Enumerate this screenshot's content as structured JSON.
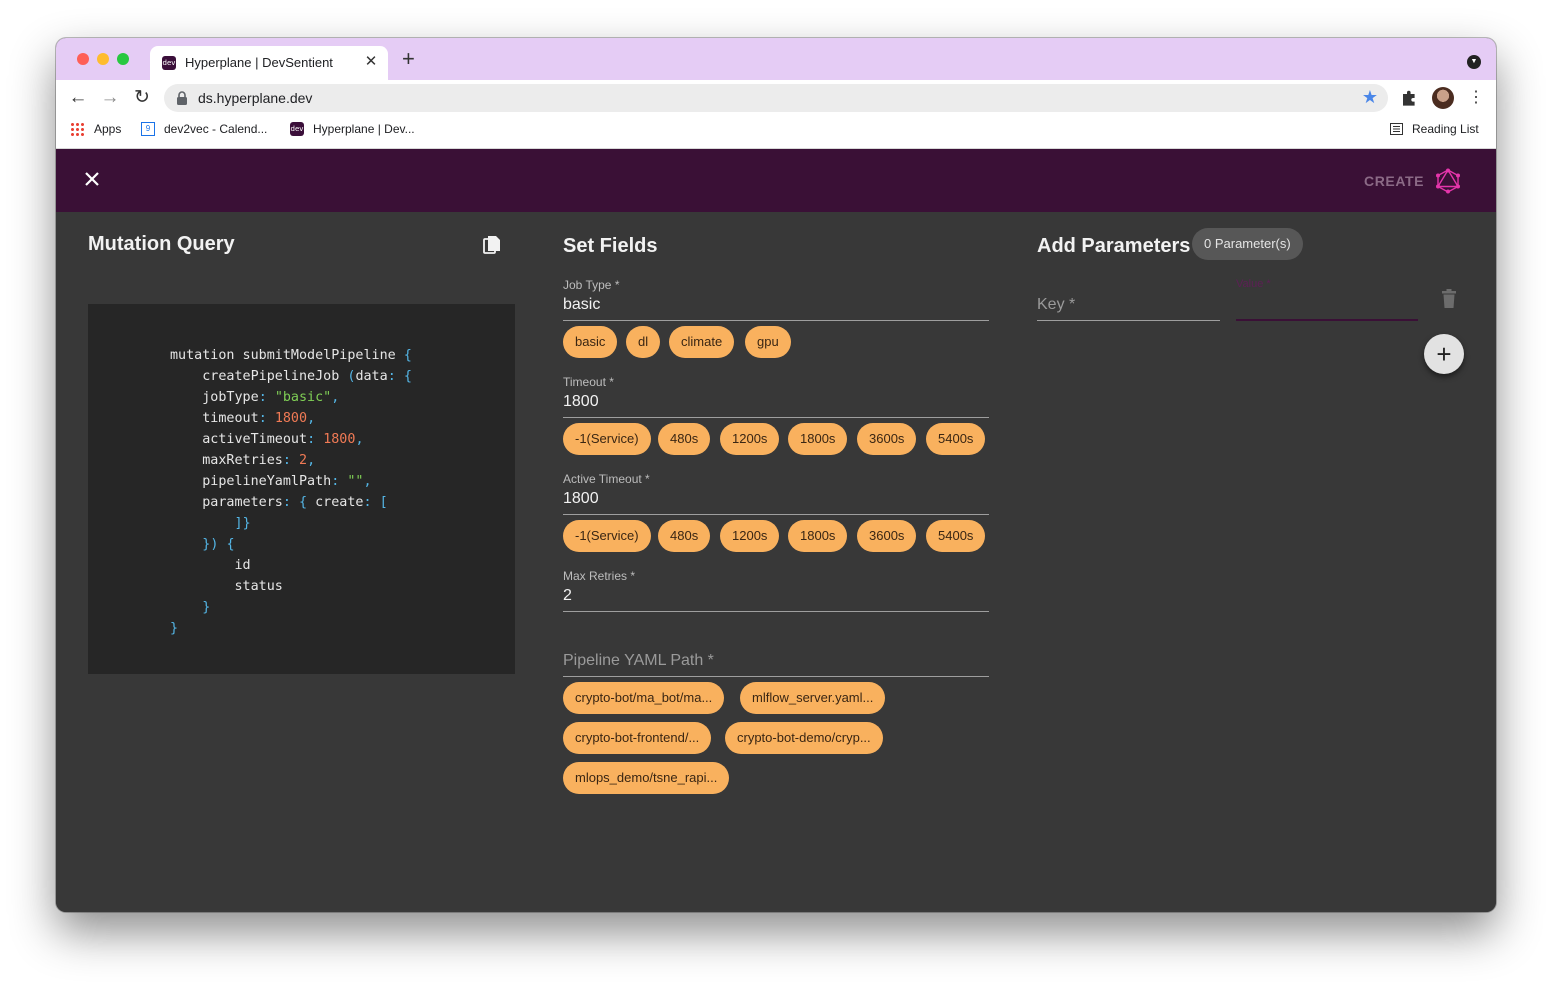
{
  "browser": {
    "tab_title": "Hyperplane | DevSentient",
    "favicon_text": "dev",
    "url": "ds.hyperplane.dev",
    "bookmarks": [
      {
        "label": "Apps"
      },
      {
        "label": "dev2vec - Calend..."
      },
      {
        "label": "Hyperplane | Dev..."
      }
    ],
    "reading_list": "Reading List",
    "calendar_icon_text": "9"
  },
  "appbar": {
    "create_label": "CREATE",
    "bg_color": "#3a1036",
    "icon_color": "#e535ab"
  },
  "mutation": {
    "title": "Mutation Query",
    "lines": [
      "mutation submitModelPipeline {",
      "    createPipelineJob (data: {",
      "    jobType: \"basic\",",
      "    timeout: 1800,",
      "    activeTimeout: 1800,",
      "    maxRetries: 2,",
      "    pipelineYamlPath: \"\",",
      "    parameters: { create: [",
      "        ]}",
      "    }) {",
      "        id",
      "        status",
      "    }",
      "}"
    ]
  },
  "set_fields": {
    "title": "Set Fields",
    "job_type": {
      "label": "Job Type *",
      "value": "basic",
      "chips": [
        "basic",
        "dl",
        "climate",
        "gpu"
      ]
    },
    "timeout": {
      "label": "Timeout *",
      "value": "1800",
      "chips": [
        "-1(Service)",
        "480s",
        "1200s",
        "1800s",
        "3600s",
        "5400s"
      ]
    },
    "active_timeout": {
      "label": "Active Timeout *",
      "value": "1800",
      "chips": [
        "-1(Service)",
        "480s",
        "1200s",
        "1800s",
        "3600s",
        "5400s"
      ]
    },
    "max_retries": {
      "label": "Max Retries *",
      "value": "2"
    },
    "pipeline_yaml": {
      "placeholder": "Pipeline YAML Path *",
      "chips": [
        "crypto-bot/ma_bot/ma...",
        "mlflow_server.yaml...",
        "crypto-bot-frontend/...",
        "crypto-bot-demo/cryp...",
        "mlops_demo/tsne_rapi..."
      ]
    },
    "chip_color": "#f9b15e"
  },
  "parameters": {
    "title": "Add Parameters",
    "count_badge": "0 Parameter(s)",
    "key_placeholder": "Key *",
    "value_label": "Value *"
  }
}
